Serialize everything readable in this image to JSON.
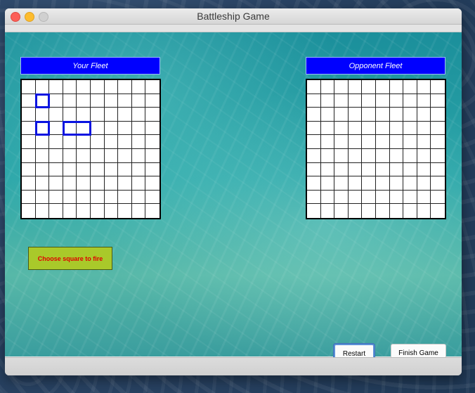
{
  "window": {
    "title": "Battleship Game"
  },
  "your_fleet": {
    "header": "Your Fleet",
    "grid_size": 10,
    "ships": [
      {
        "row": 1,
        "col": 1,
        "length": 1,
        "orientation": "horizontal"
      },
      {
        "row": 3,
        "col": 1,
        "length": 1,
        "orientation": "horizontal"
      },
      {
        "row": 3,
        "col": 3,
        "length": 2,
        "orientation": "horizontal"
      }
    ]
  },
  "opponent_fleet": {
    "header": "Opponent Fleet",
    "grid_size": 10
  },
  "status": {
    "message": "Choose square to fire"
  },
  "buttons": {
    "restart": "Restart",
    "finish": "Finish Game"
  },
  "colors": {
    "header_bg": "#0000ff",
    "status_bg": "#a9c92a",
    "status_text": "#e00000",
    "ship_outline": "#0a14e0"
  }
}
